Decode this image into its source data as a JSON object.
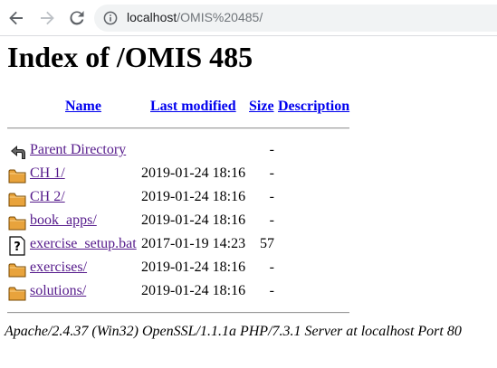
{
  "browser": {
    "url_host": "localhost",
    "url_path": "/OMIS%20485/"
  },
  "page": {
    "title": "Index of /OMIS 485"
  },
  "columns": {
    "name": "Name",
    "modified": "Last modified",
    "size": "Size",
    "description": "Description"
  },
  "rows": [
    {
      "icon": "back-arrow-icon",
      "name": "Parent Directory",
      "modified": "",
      "size": "-",
      "visited": true
    },
    {
      "icon": "folder-icon",
      "name": "CH 1/",
      "modified": "2019-01-24 18:16",
      "size": "-",
      "visited": true
    },
    {
      "icon": "folder-icon",
      "name": "CH 2/",
      "modified": "2019-01-24 18:16",
      "size": "-",
      "visited": true
    },
    {
      "icon": "folder-icon",
      "name": "book_apps/",
      "modified": "2019-01-24 18:16",
      "size": "-",
      "visited": true
    },
    {
      "icon": "unknown-file-icon",
      "name": "exercise_setup.bat",
      "modified": "2017-01-19 14:23",
      "size": "57",
      "visited": true
    },
    {
      "icon": "folder-icon",
      "name": "exercises/",
      "modified": "2019-01-24 18:16",
      "size": "-",
      "visited": true
    },
    {
      "icon": "folder-icon",
      "name": "solutions/",
      "modified": "2019-01-24 18:16",
      "size": "-",
      "visited": true
    }
  ],
  "footer": {
    "address": "Apache/2.4.37 (Win32) OpenSSL/1.1.1a PHP/7.3.1 Server at localhost Port 80"
  },
  "colors": {
    "link": "#0000ee",
    "visited": "#551a8b",
    "folder": "#e8a33c"
  }
}
